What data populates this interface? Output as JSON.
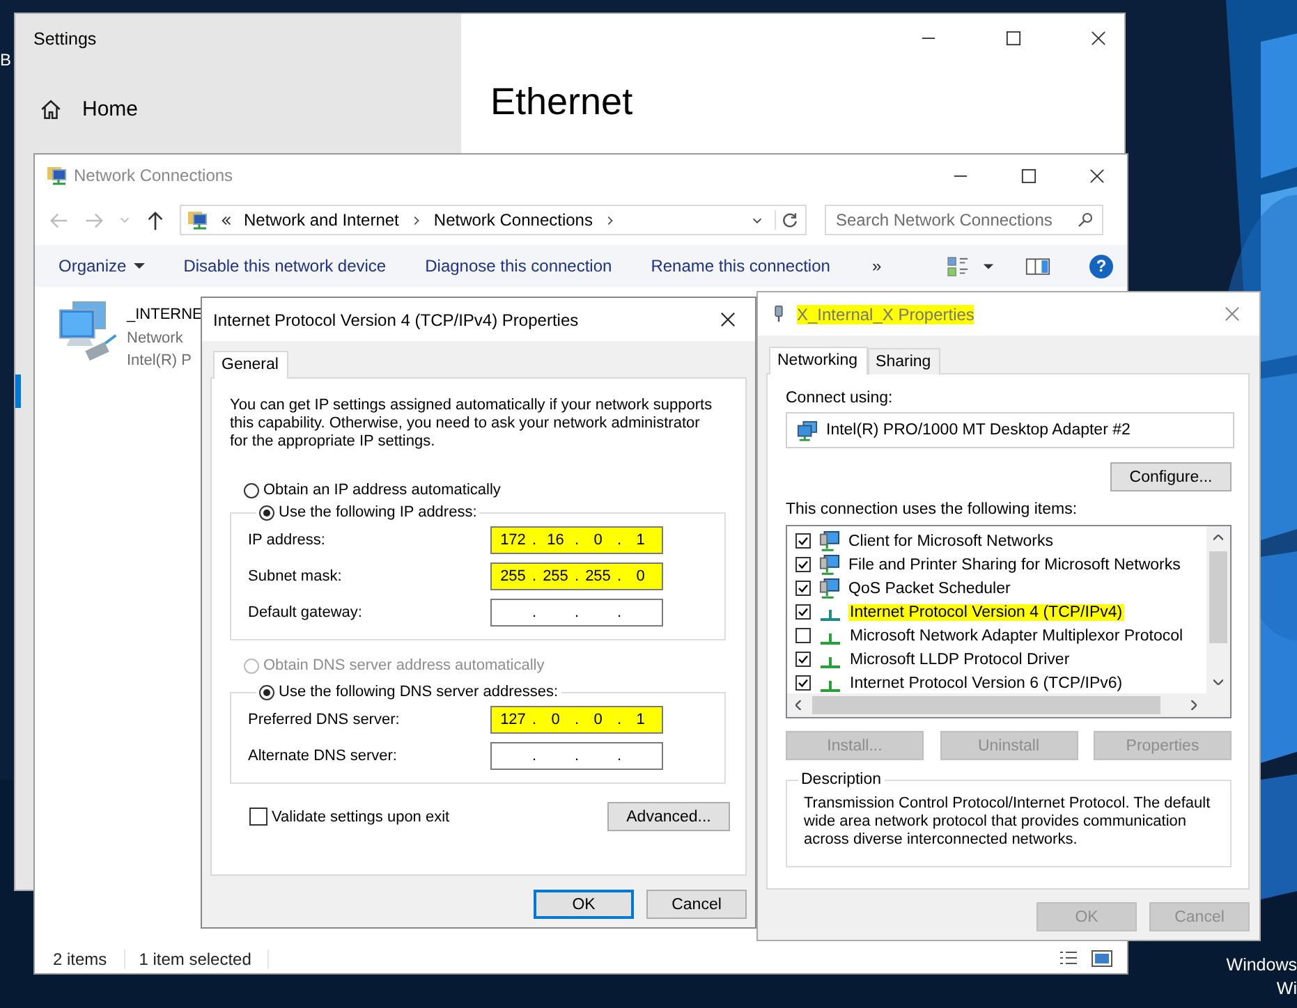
{
  "desktop": {
    "icon_label": "B",
    "activation_lines": [
      "Windows",
      "Wi"
    ]
  },
  "settings": {
    "title": "Settings",
    "nav": [
      {
        "label": "Home"
      }
    ],
    "page_title": "Ethernet"
  },
  "explorer": {
    "title": "Network Connections",
    "breadcrumb": [
      "Network and Internet",
      "Network Connections"
    ],
    "search": {
      "placeholder": "Search Network Connections"
    },
    "toolbar": [
      {
        "label": "Organize",
        "dropdown": true
      },
      {
        "label": "Disable this network device",
        "dropdown": false
      },
      {
        "label": "Diagnose this connection",
        "dropdown": false
      },
      {
        "label": "Rename this connection",
        "dropdown": false
      }
    ],
    "more": "»",
    "help": "?",
    "items": [
      {
        "lines": [
          "_INTERNE",
          "Network",
          "Intel(R) P"
        ]
      }
    ],
    "status": [
      "2 items",
      "1 item selected"
    ]
  },
  "ipv4_dialog": {
    "title": "Internet Protocol Version 4 (TCP/IPv4) Properties",
    "tabs": [
      {
        "label": "General",
        "selected": true
      }
    ],
    "intro": "You can get IP settings assigned automatically if your network supports this capability. Otherwise, you need to ask your network administrator for the appropriate IP settings.",
    "ip_mode": [
      {
        "label": "Obtain an IP address automatically",
        "selected": false,
        "disabled": false
      },
      {
        "label": "Use the following IP address:",
        "selected": true,
        "disabled": false
      }
    ],
    "ip_fields": [
      {
        "label": "IP address:",
        "parts": [
          "172",
          ".",
          "16",
          ".",
          "0",
          ".",
          "1"
        ],
        "highlighted": true
      },
      {
        "label": "Subnet mask:",
        "parts": [
          "255",
          ".",
          "255",
          ".",
          "255",
          ".",
          "0"
        ],
        "highlighted": true
      },
      {
        "label": "Default gateway:",
        "parts": [
          ".",
          ".",
          "."
        ],
        "highlighted": false
      }
    ],
    "dns_mode": [
      {
        "label": "Obtain DNS server address automatically",
        "selected": false,
        "disabled": true
      },
      {
        "label": "Use the following DNS server addresses:",
        "selected": true,
        "disabled": false
      }
    ],
    "dns_fields": [
      {
        "label": "Preferred DNS server:",
        "parts": [
          "127",
          ".",
          "0",
          ".",
          "0",
          ".",
          "1"
        ],
        "highlighted": true
      },
      {
        "label": "Alternate DNS server:",
        "parts": [
          ".",
          ".",
          "."
        ],
        "highlighted": false
      }
    ],
    "validate": {
      "label": "Validate settings upon exit",
      "checked": false
    },
    "advanced": "Advanced...",
    "footer": [
      {
        "label": "OK",
        "default": true
      },
      {
        "label": "Cancel",
        "default": false
      }
    ]
  },
  "adapter_dialog": {
    "title": "X_Internal_X Properties",
    "title_highlighted": true,
    "tabs": [
      {
        "label": "Networking",
        "selected": true
      },
      {
        "label": "Sharing",
        "selected": false
      }
    ],
    "connect_label": "Connect using:",
    "adapter": "Intel(R) PRO/1000 MT Desktop Adapter #2",
    "configure": "Configure...",
    "items_label": "This connection uses the following items:",
    "items": [
      {
        "label": "Client for Microsoft Networks",
        "checked": true,
        "kind": "service",
        "highlighted": false
      },
      {
        "label": "File and Printer Sharing for Microsoft Networks",
        "checked": true,
        "kind": "service",
        "highlighted": false
      },
      {
        "label": "QoS Packet Scheduler",
        "checked": true,
        "kind": "service",
        "highlighted": false
      },
      {
        "label": "Internet Protocol Version 4 (TCP/IPv4)",
        "checked": true,
        "kind": "protocol",
        "highlighted": true
      },
      {
        "label": "Microsoft Network Adapter Multiplexor Protocol",
        "checked": false,
        "kind": "protocol",
        "highlighted": false
      },
      {
        "label": "Microsoft LLDP Protocol Driver",
        "checked": true,
        "kind": "protocol",
        "highlighted": false
      },
      {
        "label": "Internet Protocol Version 6 (TCP/IPv6)",
        "checked": true,
        "kind": "protocol",
        "highlighted": false
      }
    ],
    "actions": [
      {
        "label": "Install...",
        "disabled": true
      },
      {
        "label": "Uninstall",
        "disabled": true
      },
      {
        "label": "Properties",
        "disabled": true
      }
    ],
    "description": {
      "legend": "Description",
      "text": "Transmission Control Protocol/Internet Protocol. The default wide area network protocol that provides communication across diverse interconnected networks."
    },
    "footer": [
      {
        "label": "OK",
        "disabled": true
      },
      {
        "label": "Cancel",
        "disabled": true
      }
    ]
  }
}
